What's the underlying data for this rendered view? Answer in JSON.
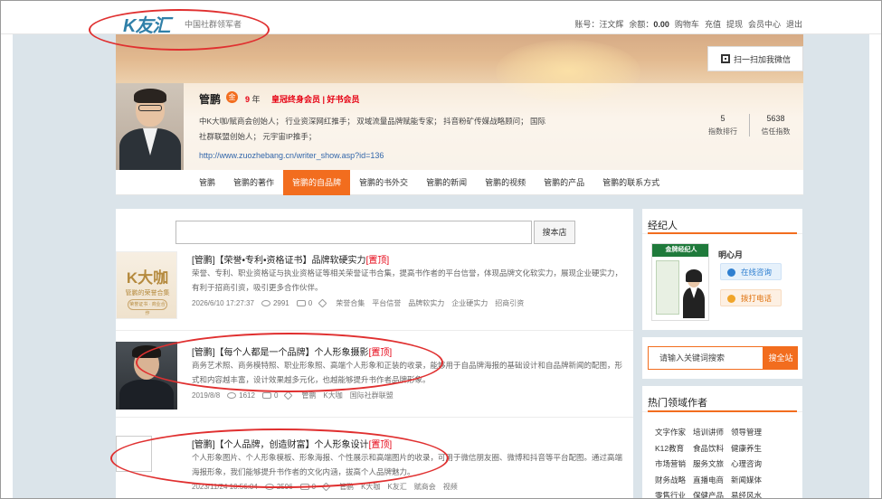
{
  "topbar": {
    "logo": "K友汇",
    "slogan": "中国社群领军者",
    "account_label": "账号：汪文辉",
    "balance_label": "余额：",
    "balance_value": "0.00",
    "links": [
      "购物车",
      "充值",
      "提现",
      "会员中心",
      "退出"
    ]
  },
  "banner": {
    "wechat_label": "扫一扫加我微信"
  },
  "profile": {
    "name": "管鹏",
    "medal": "金",
    "years_value": "9",
    "years_unit": "年",
    "vip": "皇冠终身会员 | 好书会员",
    "bio_line1": "中K大咖/赋商会创始人； 行业资深网红推手； 双域流量品牌赋能专家； 抖音粉矿传媒战略顾问； 国际",
    "bio_line2": "社群联盟创始人； 元宇宙IP推手；",
    "url": "http://www.zuozhebang.cn/writer_show.asp?id=136",
    "stats": [
      {
        "value": "5",
        "label": "指数排行"
      },
      {
        "value": "5638",
        "label": "信任指数"
      }
    ]
  },
  "nav": {
    "tabs": [
      "管鹏",
      "管鹏的著作",
      "管鹏的自品牌",
      "管鹏的书外交",
      "管鹏的新闻",
      "管鹏的视频",
      "管鹏的产品",
      "管鹏的联系方式"
    ],
    "active_index": 2
  },
  "search": {
    "button": "搜本店"
  },
  "items": [
    {
      "title": "[管鹏]【荣誉•专利•资格证书】品牌软硬实力",
      "tag": "[置顶]",
      "desc": "荣誉、专利、职业资格证与执业资格证等相关荣誉证书合集，提高书作者的平台信誉，体现品牌文化软实力，展现企业硬实力，有利于招商引资，吸引更多合作伙伴。",
      "date": "2026/6/10 17:27:37",
      "views": "2991",
      "comments": "0",
      "tags": [
        "荣誉合集",
        "平台信誉",
        "品牌软实力",
        "企业硬实力",
        "招商引资"
      ],
      "thumb_big": "K大咖",
      "thumb_sub": "管鹏的荣誉合集",
      "thumb_ring": "荣誉证书 · 商业合作"
    },
    {
      "title": "[管鹏]【每个人都是一个品牌】个人形象摄影",
      "tag": "[置顶]",
      "desc": "商务艺术照、商务模特照、职业形象照、高端个人形象和正装的收录，能够用于自品牌海报的基础设计和自品牌新闻的配图，形式和内容越丰富，设计效果越多元化，也越能够提升书作者品牌形象。",
      "date": "2019/8/8",
      "views": "1612",
      "comments": "0",
      "tags": [
        "管鹏",
        "K大咖",
        "国际社群联盟"
      ]
    },
    {
      "title": "[管鹏]【个人品牌，创造财富】个人形象设计",
      "tag": "[置顶]",
      "desc": "个人形象图片、个人形象模板、形象海报、个性展示和高端图片的收录，可用于微信朋友圈、微博和抖音等平台配图。通过高端海报形象，我们能够提升书作者的文化内涵，拔高个人品牌魅力。",
      "date": "2023/11/24 10:56:04",
      "views": "2596",
      "comments": "0",
      "tags": [
        "管鹏",
        "K大咖",
        "K友汇",
        "赋商会",
        "视频"
      ]
    }
  ],
  "sidebar": {
    "agent_title": "经纪人",
    "book_top": "金牌经纪人",
    "agent_name": "明心月",
    "consult": "在线咨询",
    "call": "拨打电话",
    "keyword_placeholder": "请输入关键词搜索",
    "keyword_button": "搜全站",
    "hot_title": "热门领域作者",
    "categories": [
      "文字作家",
      "培训讲师",
      "领导管理",
      "K12教育",
      "食品饮料",
      "健康养生",
      "市场营销",
      "服务文旅",
      "心理咨询",
      "财务战略",
      "直播电商",
      "新闻媒体",
      "零售行业",
      "保健产品",
      "易经风水"
    ]
  },
  "colors": {
    "accent": "#f26d1e",
    "highlight_red": "#e60012",
    "link_blue": "#3366aa",
    "annotation_red": "#e03030"
  }
}
